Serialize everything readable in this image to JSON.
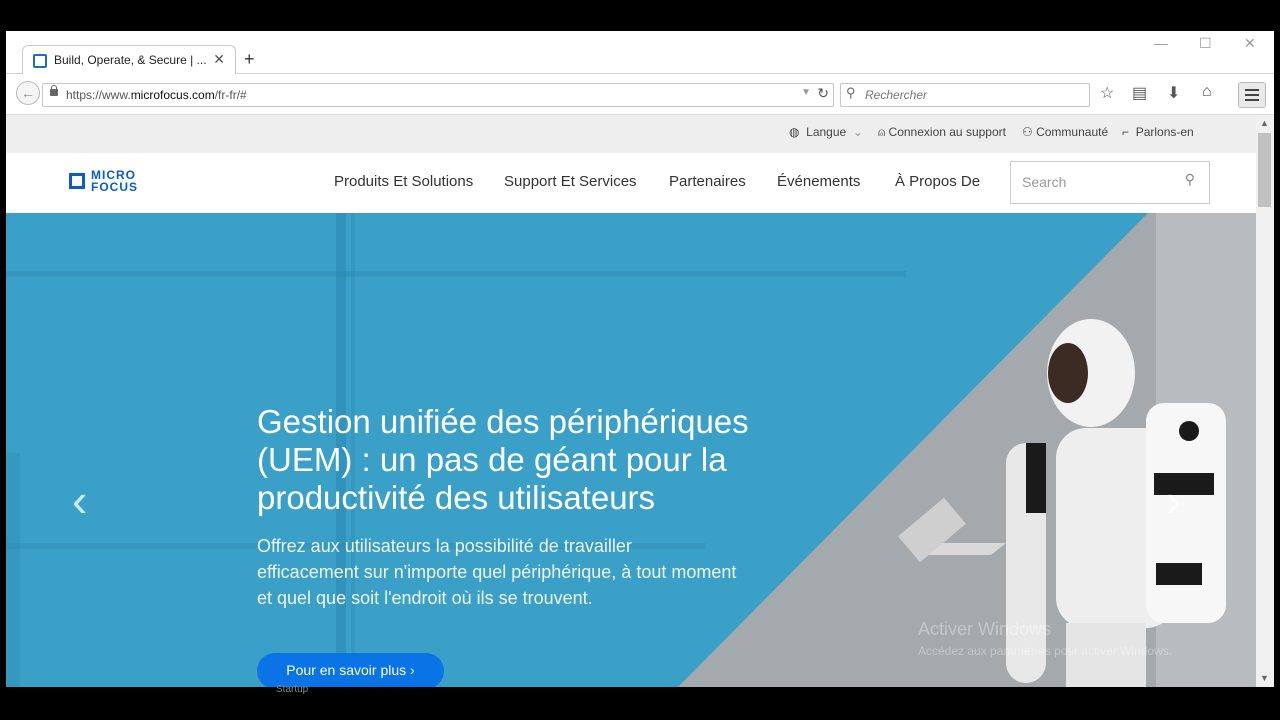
{
  "browser": {
    "tab": {
      "title": "Build, Operate, & Secure | ..."
    },
    "url": {
      "prefix": "https://www.",
      "domain": "microfocus.com",
      "path": "/fr-fr/#"
    },
    "search_placeholder": "Rechercher"
  },
  "utility_nav": {
    "items": [
      "Langue",
      "Connexion au support",
      "Communauté",
      "Parlons-en"
    ]
  },
  "header": {
    "logo": {
      "line1": "MICRO",
      "line2": "FOCUS"
    },
    "nav": [
      "Produits Et Solutions",
      "Support Et Services",
      "Partenaires",
      "Événements",
      "À Propos De"
    ],
    "search_placeholder": "Search"
  },
  "hero": {
    "title": "Gestion unifiée des périphériques (UEM) : un pas de géant pour la productivité des utilisateurs",
    "subtitle": "Offrez aux utilisateurs la possibilité de travailler efficacement sur n'importe quel périphérique, à tout moment et quel que soit l'endroit où ils se trouvent.",
    "cta": "Pour en savoir plus ›"
  },
  "watermark": {
    "line1": "Activer Windows",
    "line2": "Accédez aux paramètres pour activer Windows."
  },
  "taskbar": {
    "item": "Startup"
  },
  "colors": {
    "brand": "#0a5cc7",
    "hero_blue": "#2f9cc6",
    "cta": "#0a73e6"
  }
}
